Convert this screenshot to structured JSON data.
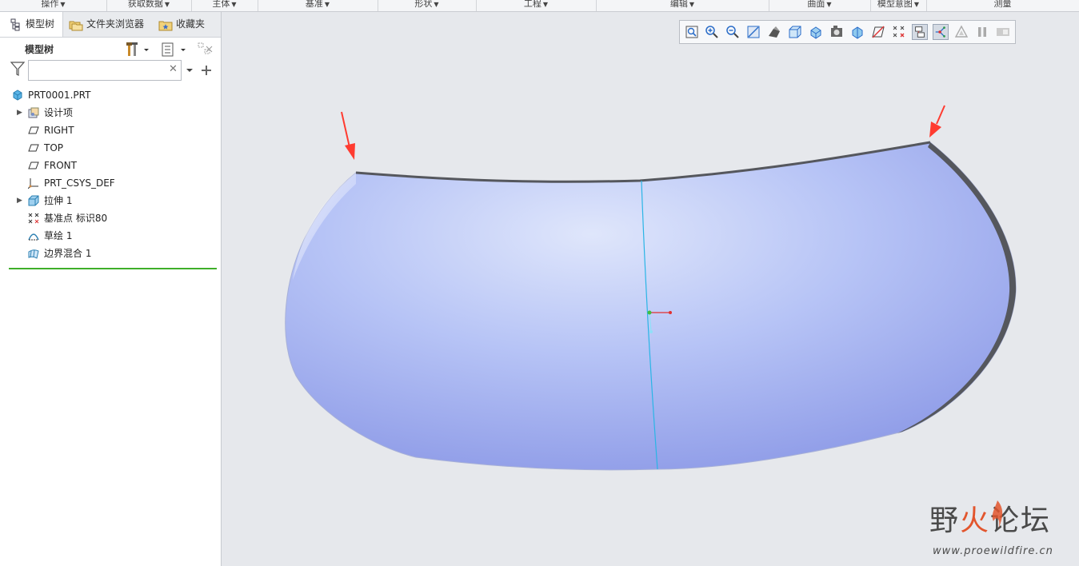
{
  "ribbon": {
    "groups": [
      {
        "label": "操作"
      },
      {
        "label": "获取数据"
      },
      {
        "label": "主体"
      },
      {
        "label": "基准"
      },
      {
        "label": "形状"
      },
      {
        "label": "工程"
      },
      {
        "label": "编辑"
      },
      {
        "label": "曲面"
      },
      {
        "label": "模型意图"
      },
      {
        "label": "测量"
      }
    ]
  },
  "left_panel": {
    "tabs": [
      {
        "label": "模型树",
        "icon": "model-tree-icon"
      },
      {
        "label": "文件夹浏览器",
        "icon": "folder-browser-icon"
      },
      {
        "label": "收藏夹",
        "icon": "favorites-icon"
      }
    ],
    "title": "模型树",
    "search": {
      "value": "",
      "placeholder": ""
    },
    "tree": [
      {
        "label": "PRT0001.PRT",
        "icon": "part-icon",
        "expandable": false
      },
      {
        "label": "设计项",
        "icon": "design-items-icon",
        "expandable": true
      },
      {
        "label": "RIGHT",
        "icon": "datum-plane-icon",
        "expandable": false
      },
      {
        "label": "TOP",
        "icon": "datum-plane-icon",
        "expandable": false
      },
      {
        "label": "FRONT",
        "icon": "datum-plane-icon",
        "expandable": false
      },
      {
        "label": "PRT_CSYS_DEF",
        "icon": "coordinate-system-icon",
        "expandable": false
      },
      {
        "label": "拉伸 1",
        "icon": "extrude-icon",
        "expandable": true
      },
      {
        "label": "基准点 标识80",
        "icon": "datum-point-icon",
        "expandable": false
      },
      {
        "label": "草绘 1",
        "icon": "sketch-icon",
        "expandable": false
      },
      {
        "label": "边界混合 1",
        "icon": "boundary-blend-icon",
        "expandable": false
      }
    ]
  },
  "view_toolbar": {
    "buttons": [
      "refit-icon",
      "zoom-in-icon",
      "zoom-out-icon",
      "repaint-icon",
      "display-style-icon",
      "saved-orientations-icon",
      "view-manager-icon",
      "perspective-icon",
      "section-icon",
      "datum-display-icon",
      "point-display-icon",
      "annotation-display-icon",
      "spin-center-icon",
      "model-display-icon",
      "pause-icon",
      "appearance-icon"
    ]
  },
  "colors": {
    "surface_light": "#dfe6fb",
    "surface_mid": "#b7c4f6",
    "surface_dark": "#8b98e6",
    "edge_dark": "#55575d",
    "arrow_red": "#ff3b30",
    "sketch_line": "#2ab5e6"
  },
  "watermark": {
    "title_a": "野",
    "title_b": "火",
    "title_c": "论坛",
    "url": "www.proewildfire.cn"
  }
}
